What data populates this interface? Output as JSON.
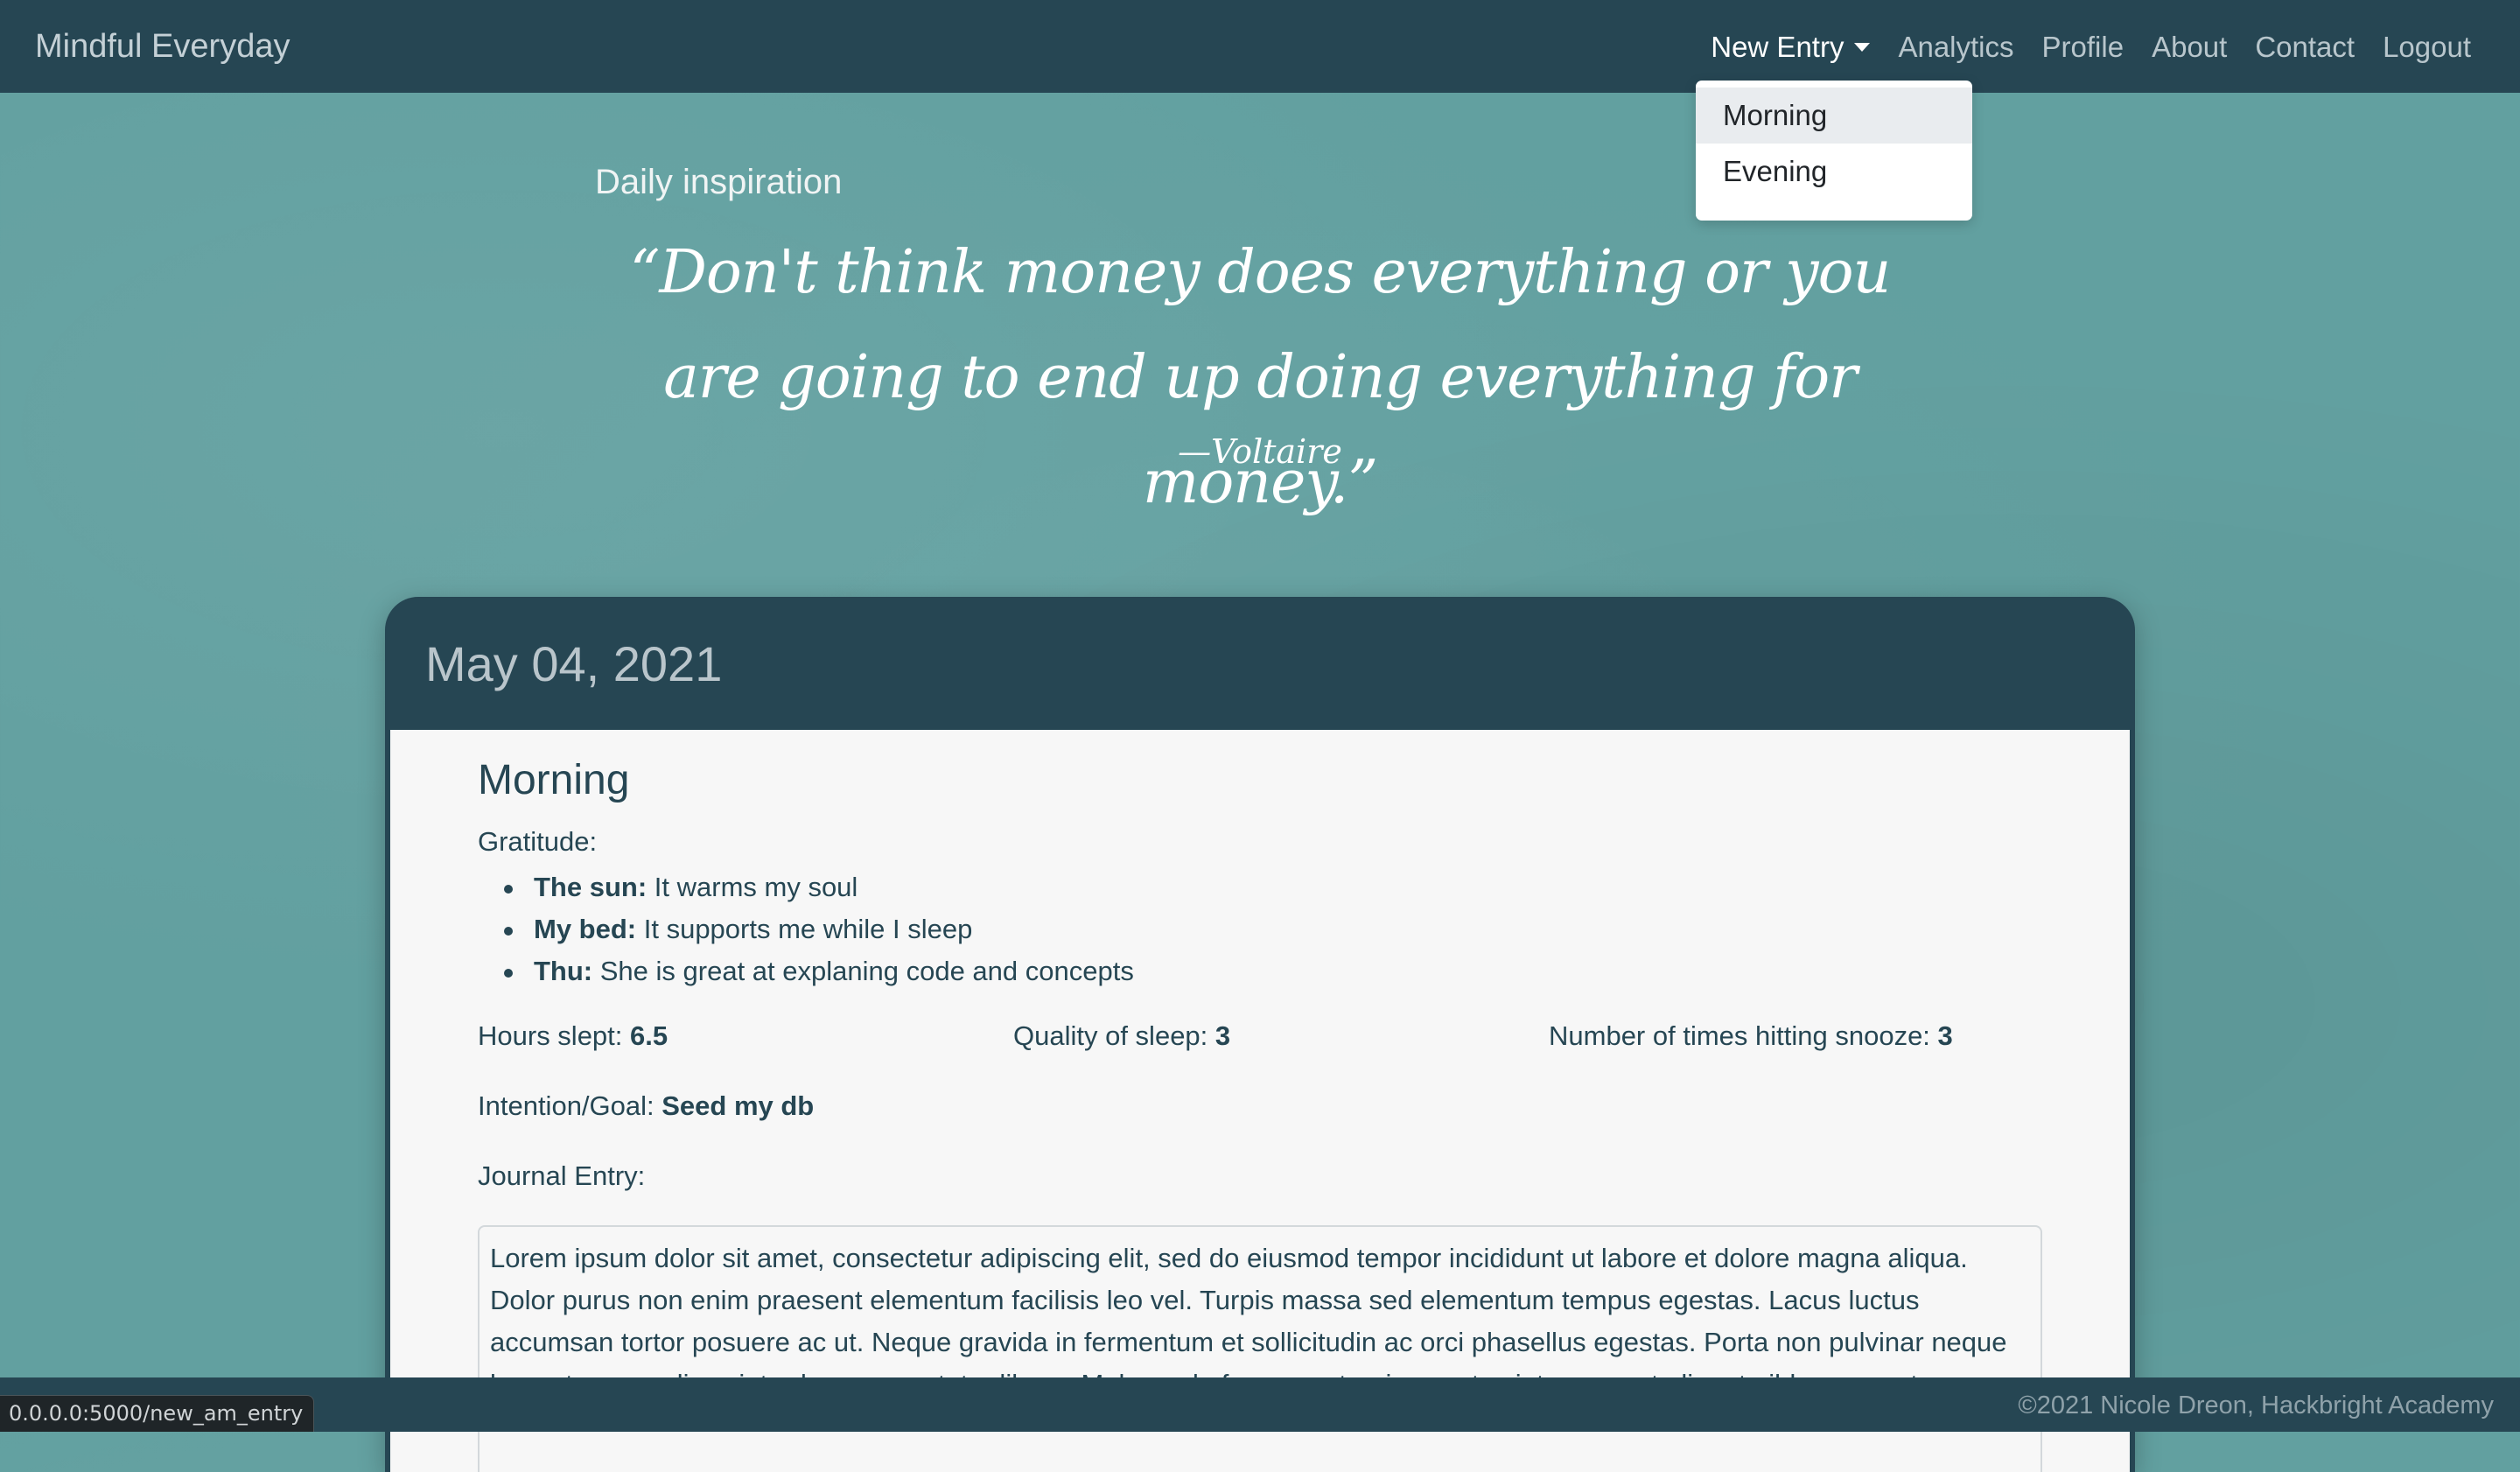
{
  "navbar": {
    "brand": "Mindful Everyday",
    "links": [
      {
        "label": "New Entry"
      },
      {
        "label": "Analytics"
      },
      {
        "label": "Profile"
      },
      {
        "label": "About"
      },
      {
        "label": "Contact"
      },
      {
        "label": "Logout"
      }
    ],
    "dropdown": [
      "Morning",
      "Evening"
    ]
  },
  "hero": {
    "heading": "Daily inspiration",
    "quote": "“Don't think money does everything or you are going to end up doing everything for money.”",
    "author": "—Voltaire"
  },
  "entry": {
    "date": "May 04, 2021",
    "section_title": "Morning",
    "gratitude_label": "Gratitude:",
    "gratitude": [
      {
        "title": "The sun:",
        "text": " It warms my soul"
      },
      {
        "title": "My bed:",
        "text": " It supports me while I sleep"
      },
      {
        "title": "Thu:",
        "text": " She is great at explaning code and concepts"
      }
    ],
    "hours_label": "Hours slept: ",
    "hours_value": "6.5",
    "quality_label": "Quality of sleep: ",
    "quality_value": "3",
    "snooze_label": "Number of times hitting snooze: ",
    "snooze_value": "3",
    "intention_label": "Intention/Goal: ",
    "intention_value": "Seed my db",
    "journal_label": "Journal Entry:",
    "journal_text": "Lorem ipsum dolor sit amet, consectetur adipiscing elit, sed do eiusmod tempor incididunt ut labore et dolore magna aliqua. Dolor purus non enim praesent elementum facilisis leo vel. Turpis massa sed elementum tempus egestas. Lacus luctus accumsan tortor posuere ac ut. Neque gravida in fermentum et sollicitudin ac orci phasellus egestas. Porta non pulvinar neque laoreet suspendisse interdum consectetur libero. Malesuada fames ac turpis egestas integer eget aliquet nibh praesent."
  },
  "footer": {
    "text": "©2021 Nicole Dreon, Hackbright Academy"
  },
  "status_bar": {
    "url": "0.0.0.0:5000/new_am_entry"
  }
}
